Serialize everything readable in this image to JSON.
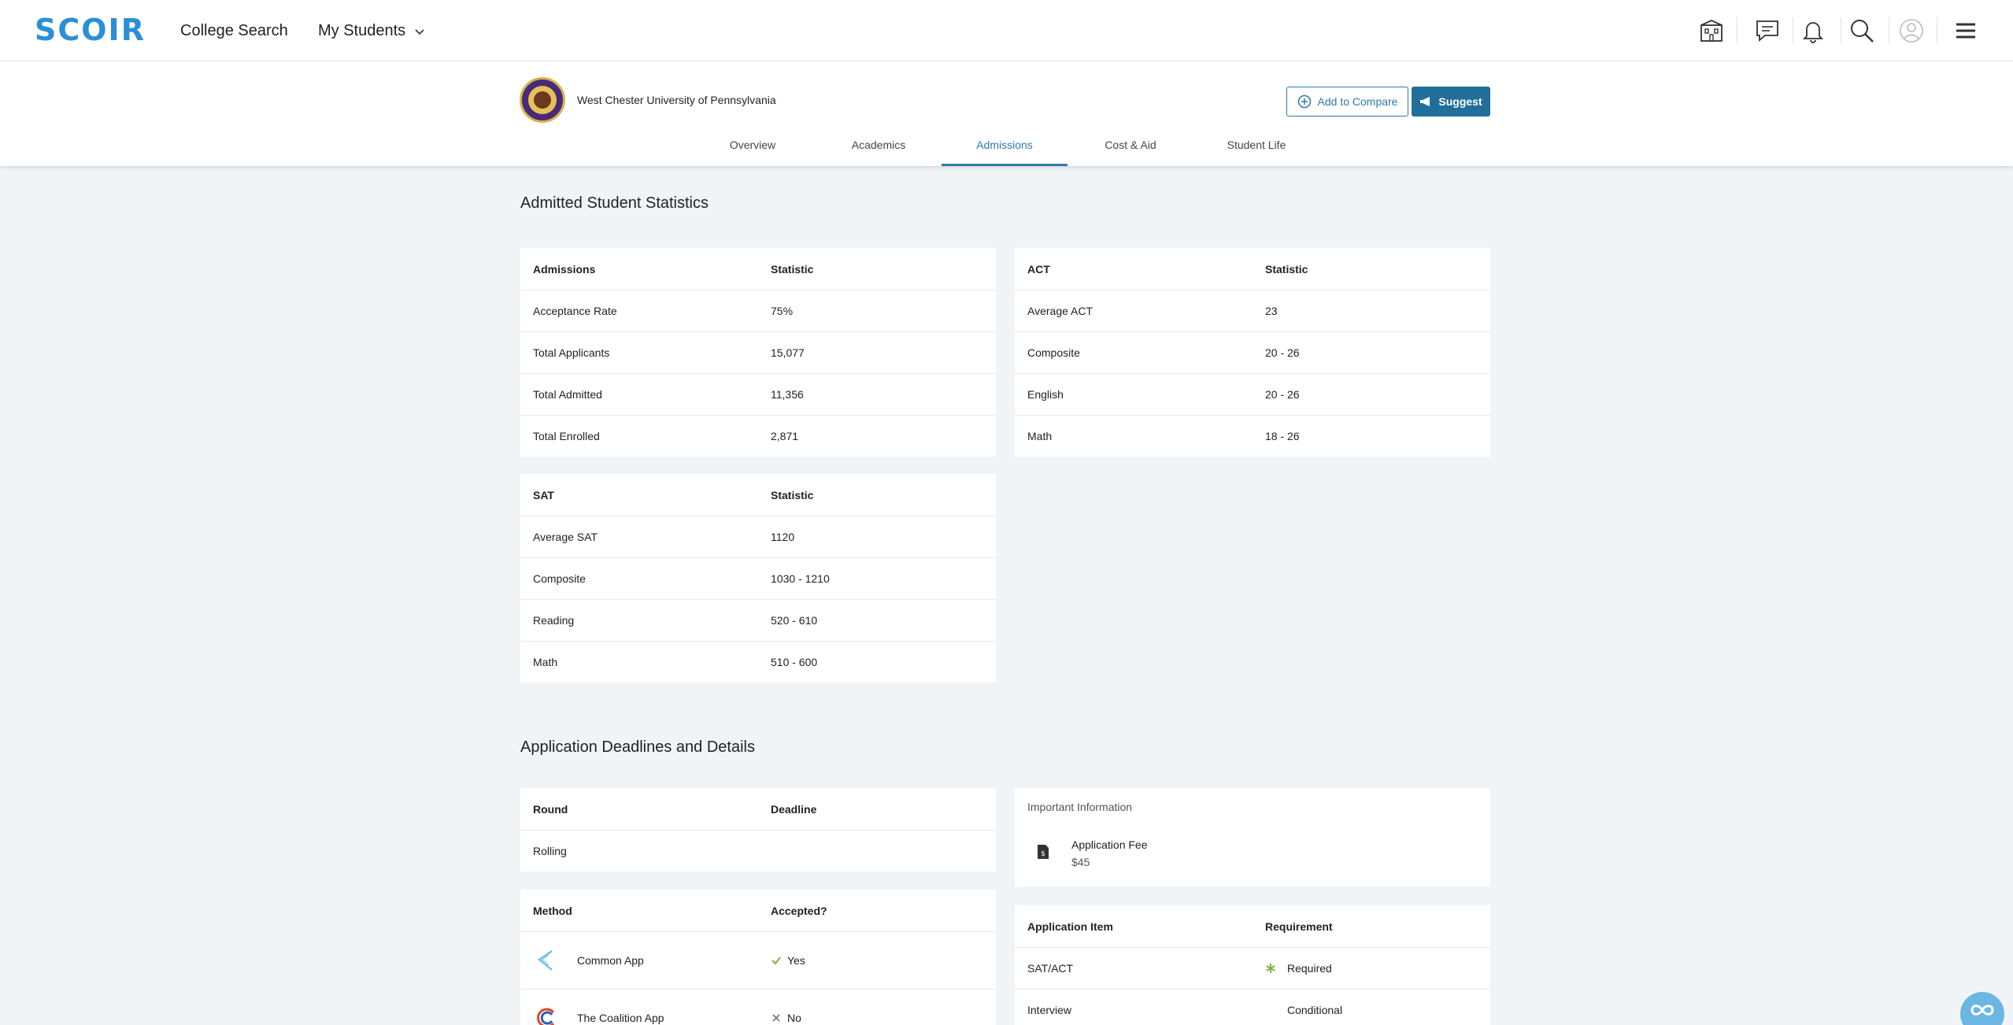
{
  "topnav": {
    "logo": "SCOIR",
    "college_search": "College Search",
    "my_students": "My Students",
    "icons": [
      "college-building-icon",
      "message-icon",
      "bell-icon",
      "search-icon",
      "profile-icon",
      "menu-icon"
    ]
  },
  "college": {
    "name": "West Chester University of Pennsylvania",
    "add_compare": "Add to Compare",
    "suggest": "Suggest",
    "tabs": [
      {
        "label": "Overview"
      },
      {
        "label": "Academics"
      },
      {
        "label": "Admissions",
        "active": true
      },
      {
        "label": "Cost & Aid"
      },
      {
        "label": "Student Life"
      }
    ]
  },
  "stats": {
    "title": "Admitted Student Statistics",
    "admissions": {
      "headers": [
        "Admissions",
        "Statistic"
      ],
      "rows": [
        [
          "Acceptance Rate",
          "75%"
        ],
        [
          "Total Applicants",
          "15,077"
        ],
        [
          "Total Admitted",
          "11,356"
        ],
        [
          "Total Enrolled",
          "2,871"
        ]
      ]
    },
    "act": {
      "headers": [
        "ACT",
        "Statistic"
      ],
      "rows": [
        [
          "Average ACT",
          "23"
        ],
        [
          "Composite",
          "20 - 26"
        ],
        [
          "English",
          "20 - 26"
        ],
        [
          "Math",
          "18 - 26"
        ]
      ]
    },
    "sat": {
      "headers": [
        "SAT",
        "Statistic"
      ],
      "rows": [
        [
          "Average SAT",
          "1120"
        ],
        [
          "Composite",
          "1030 - 1210"
        ],
        [
          "Reading",
          "520 - 610"
        ],
        [
          "Math",
          "510 - 600"
        ]
      ]
    }
  },
  "deadlines": {
    "title": "Application Deadlines and Details",
    "rounds": {
      "headers": [
        "Round",
        "Deadline"
      ],
      "rows": [
        [
          "Rolling",
          ""
        ]
      ]
    },
    "methods": {
      "headers": [
        "Method",
        "Accepted?"
      ],
      "rows": [
        {
          "name": "Common App",
          "accepted": "Yes",
          "status_icon": "check-icon"
        },
        {
          "name": "The Coalition App",
          "accepted": "No",
          "status_icon": "x-icon"
        }
      ]
    },
    "important": {
      "title": "Important Information",
      "fee_label": "Application Fee",
      "fee_value": "$45"
    },
    "items": {
      "headers": [
        "Application Item",
        "Requirement"
      ],
      "rows": [
        {
          "item": "SAT/ACT",
          "requirement": "Required",
          "icon": "asterisk-icon"
        },
        {
          "item": "Interview",
          "requirement": "Conditional",
          "icon": ""
        }
      ]
    }
  },
  "colors": {
    "brand": "#2b8fd6",
    "accent": "#2b7cab",
    "suggest_bg": "#226e9b",
    "check": "#7cb342",
    "background": "#f1f4f7"
  }
}
